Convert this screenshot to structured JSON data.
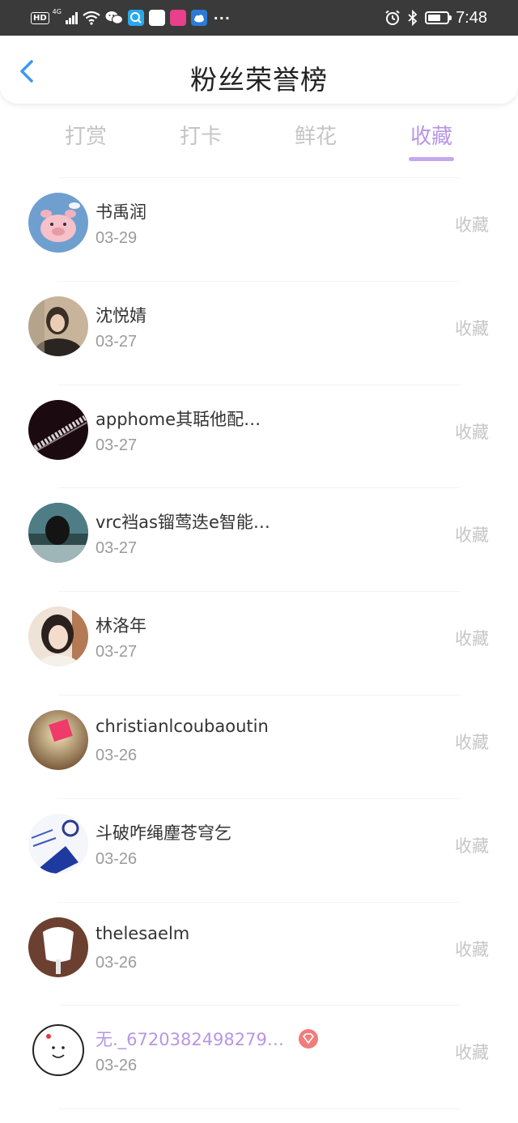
{
  "status_bar": {
    "left_badge": "HD",
    "network": "4G",
    "more": "···",
    "time": "7:48",
    "battery_level": 0.7,
    "app_icon_colors": [
      "#29a8f0",
      "#ffffff",
      "#e8408a",
      "#2a7bd6"
    ]
  },
  "header": {
    "title": "粉丝荣誉榜",
    "back_icon": "chevron-left-icon",
    "back_color": "#3a9bec"
  },
  "tabs": [
    {
      "label": "打赏",
      "active": false
    },
    {
      "label": "打卡",
      "active": false
    },
    {
      "label": "鲜花",
      "active": false
    },
    {
      "label": "收藏",
      "active": true
    }
  ],
  "colors": {
    "accent": "#b896e4",
    "muted": "#c5c5c5",
    "date": "#9b9b9b"
  },
  "fans": [
    {
      "name": "书禹润",
      "date": "03-29",
      "action": "收藏",
      "vip": false
    },
    {
      "name": "沈悦婧",
      "date": "03-27",
      "action": "收藏",
      "vip": false
    },
    {
      "name": "apphome其聒他配…",
      "date": "03-27",
      "action": "收藏",
      "vip": false
    },
    {
      "name": "vrc裆as镏莺迭e智能…",
      "date": "03-27",
      "action": "收藏",
      "vip": false
    },
    {
      "name": "林洛年",
      "date": "03-27",
      "action": "收藏",
      "vip": false
    },
    {
      "name": "christianlcoubaoutin",
      "date": "03-26",
      "action": "收藏",
      "vip": false
    },
    {
      "name": "斗破咋绳麈苍穹乞",
      "date": "03-26",
      "action": "收藏",
      "vip": false
    },
    {
      "name": "thelesaelm",
      "date": "03-26",
      "action": "收藏",
      "vip": false
    },
    {
      "name": "无._6720382498279…",
      "date": "03-26",
      "action": "收藏",
      "vip": true
    }
  ]
}
